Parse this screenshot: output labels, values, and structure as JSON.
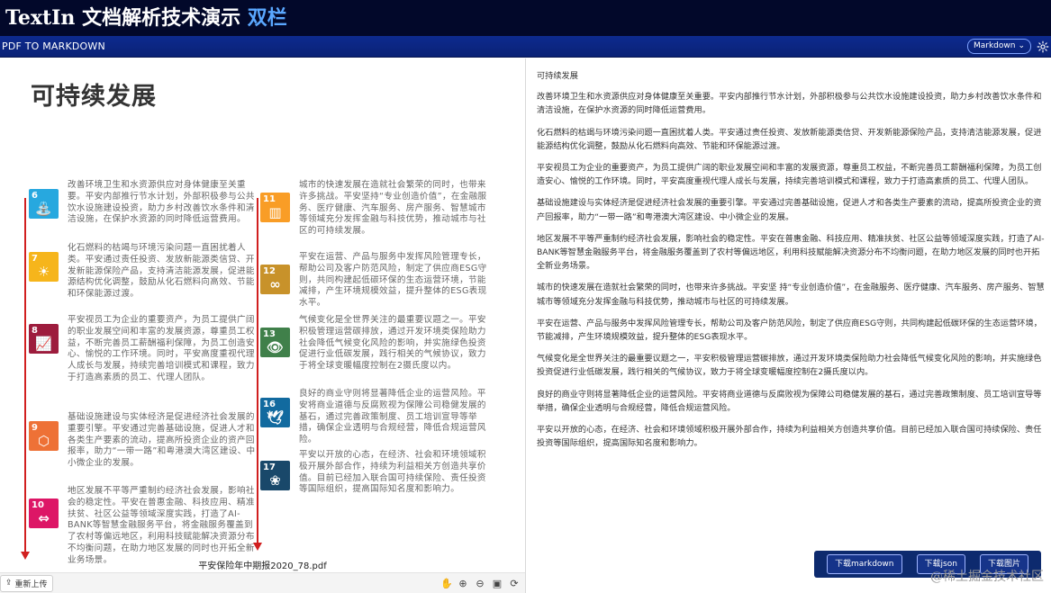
{
  "banner": {
    "title_main": "TextIn 文档解析技术演示",
    "title_accent": "双栏"
  },
  "toolbar": {
    "label": "PDF TO MARKDOWN",
    "format_select": "Markdown"
  },
  "document": {
    "title": "可持续发展",
    "file_name": "平安保险年中期报2020_78.pdf",
    "left_column": [
      {
        "num": "6",
        "color": "#27a8df",
        "glyph": "⛲",
        "text": "改善环境卫生和水资源供应对身体健康至关重要。平安内部推行节水计划，外部积极参与公共饮水设施建设投资，助力乡村改善饮水条件和清洁设施，在保护水资源的同时降低运营费用。"
      },
      {
        "num": "7",
        "color": "#f6b51b",
        "glyph": "☀",
        "text": "化石燃料的枯竭与环境污染问题一直困扰着人类。平安通过责任投资、发放新能源类信贷、开发新能源保险产品，支持清洁能源发展，促进能源结构优化调整，鼓励从化石燃料向高效、节能和环保能源过渡。"
      },
      {
        "num": "8",
        "color": "#9d1c3d",
        "glyph": "📈",
        "text": "平安视员工为企业的重要资产，为员工提供广阔的职业发展空间和丰富的发展资源，尊重员工权益，不断完善员工薪酬福利保障，为员工创造安心、愉悦的工作环境。同时，平安高度重视代理人成长与发展，持续完善培训模式和课程，致力于打造高素质的员工、代理人团队。"
      },
      {
        "num": "9",
        "color": "#ee7136",
        "glyph": "⬡",
        "text": "基础设施建设与实体经济是促进经济社会发展的重要引擎。平安通过完善基础设施，促进人才和各类生产要素的流动，提高所投资企业的资产回报率，助力“一带一路”和粤港澳大湾区建设、中小微企业的发展。"
      },
      {
        "num": "10",
        "color": "#dd1666",
        "glyph": "⇔",
        "text": "地区发展不平等严重制约经济社会发展，影响社会的稳定性。平安在普惠金融、科技应用、精准扶贫、社区公益等领域深度实践，打造了AI-BANK等智慧金融服务平台，将金融服务覆盖到了农村等偏远地区，利用科技赋能解决资源分布不均衡问题，在助力地区发展的同时也开拓全新业务场景。"
      }
    ],
    "right_column": [
      {
        "num": "11",
        "color": "#f99d26",
        "glyph": "▥",
        "text": "城市的快速发展在造就社会繁荣的同时，也带来许多挑战。平安坚持“专业创造价值”，在金融服务、医疗健康、汽车服务、房产服务、智慧城市等领域充分发挥金融与科技优势，推动城市与社区的可持续发展。"
      },
      {
        "num": "12",
        "color": "#c8922a",
        "glyph": "∞",
        "text": "平安在运营、产品与服务中发挥风险管理专长，帮助公司及客户防范风险，制定了供应商ESG守则，共同构建起低碳环保的生态运营环境，节能减排，产生环境规模效益，提升整体的ESG表现水平。"
      },
      {
        "num": "13",
        "color": "#40804a",
        "glyph": "👁",
        "text": "气候变化是全世界关注的最重要议题之一。平安积极管理运营碳排放，通过开发环境类保险助力社会降低气候变化风险的影响，并实施绿色投资促进行业低碳发展，践行相关的气候协议，致力于将全球变暖幅度控制在2摄氏度以内。"
      },
      {
        "num": "16",
        "color": "#126a9f",
        "glyph": "🕊",
        "text": "良好的商业守则将显著降低企业的运营风险。平安将商业道德与反腐败视为保障公司稳健发展的基石，通过完善政策制度、员工培训宣导等举措，确保企业透明与合规经营，降低合规运营风险。"
      },
      {
        "num": "17",
        "color": "#19486a",
        "glyph": "❀",
        "text": "平安以开放的心态，在经济、社会和环境领域积极开展外部合作，持续为利益相关方创造共享价值。目前已经加入联合国可持续保险、责任投资等国际组织，提高国际知名度和影响力。"
      }
    ]
  },
  "bottom_bar": {
    "reupload_label": "重新上传",
    "reupload_icon": "upload-icon",
    "tool_icons": [
      "hand-icon",
      "zoom-in-icon",
      "zoom-out-icon",
      "fit-icon",
      "rotate-icon"
    ]
  },
  "markdown": {
    "heading": "可持续发展",
    "paragraphs": [
      "改善环境卫生和水资源供应对身体健康至关重要。平安内部推行节水计划，外部积极参与公共饮水设施建设投资，助力乡村改善饮水条件和清洁设施，在保护水资源的同时降低运营费用。",
      "化石燃料的枯竭与环境污染问题一直困扰着人类。平安通过责任投资、发放新能源类信贷、开发新能源保险产品，支持清洁能源发展，促进能源结构优化调整，鼓励从化石燃料向高效、节能和环保能源过渡。",
      "平安视员工为企业的重要资产，为员工提供广阔的职业发展空间和丰富的发展资源，尊重员工权益，不断完善员工薪酬福利保障，为员工创造安心、愉悦的工作环境。同时，平安高度重视代理人成长与发展，持续完善培训模式和课程，致力于打造高素质的员工、代理人团队。",
      "基础设施建设与实体经济是促进经济社会发展的重要引擎。平安通过完善基础设施，促进人才和各类生产要素的流动，提高所投资企业的资产回报率，助力“一带一路”和粤港澳大湾区建设、中小微企业的发展。",
      "地区发展不平等严重制约经济社会发展，影响社会的稳定性。平安在普惠金融、科技应用、精准扶贫、社区公益等领域深度实践，打造了AI-BANK等智慧金融服务平台，将金融服务覆盖到了农村等偏远地区，利用科技赋能解决资源分布不均衡问题，在助力地区发展的同时也开拓全新业务场景。",
      "城市的快速发展在造就社会繁荣的同时，也带来许多挑战。平安坚 持“专业创造价值”，在金融服务、医疗健康、汽车服务、房产服务、智慧城市等领域充分发挥金融与科技优势，推动城市与社区的可持续发展。",
      "平安在运营、产品与服务中发挥风险管理专长，帮助公司及客户防范风险，制定了供应商ESG守则，共同构建起低碳环保的生态运营环境，节能减排，产生环境规模效益，提升整体的ESG表现水平。",
      "气候变化是全世界关注的最重要议题之一，平安积极管理运营碳排放，通过开发环境类保险助力社会降低气候变化风险的影响，并实施绿色投资促进行业低碳发展，践行相关的气候协议，致力于将全球变暖幅度控制在2摄氏度以内。",
      "良好的商业守则将显著降低企业的运营风险。平安将商业道德与反腐败视为保障公司稳健发展的基石，通过完善政策制度、员工培训宣导等举措，确保企业透明与合规经营，降低合规运营风险。",
      "平安以开放的心态，在经济、社会和环境领域积极开展外部合作，持续为利益相关方创造共享价值。目前已经加入联合国可持续保险、责任投资等国际组织，提高国际知名度和影响力。"
    ]
  },
  "actions": {
    "download_markdown": "下载markdown",
    "download_json": "下载json",
    "download_image": "下载图片"
  },
  "watermark": "@稀土掘金技术社区"
}
